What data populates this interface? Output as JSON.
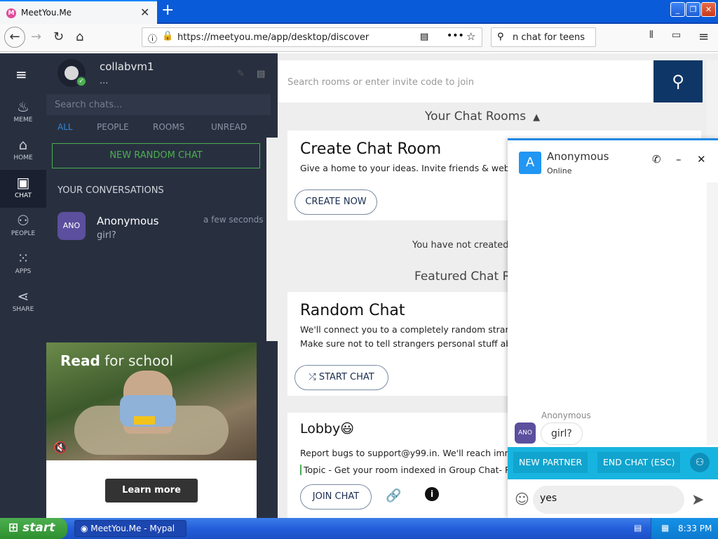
{
  "browser": {
    "tab_title": "MeetYou.Me",
    "tab_favicon": "M",
    "url": "https://meetyou.me/app/desktop/discover",
    "search_query": "n chat for teens"
  },
  "rail": [
    {
      "label": "MEME",
      "icon": "flame-icon",
      "glyph": "🔥"
    },
    {
      "label": "HOME",
      "icon": "home-icon",
      "glyph": "⌂"
    },
    {
      "label": "CHAT",
      "icon": "chat-icon",
      "glyph": "▣"
    },
    {
      "label": "PEOPLE",
      "icon": "people-icon",
      "glyph": "👥"
    },
    {
      "label": "APPS",
      "icon": "apps-icon",
      "glyph": "⁞⁞⁞"
    },
    {
      "label": "SHARE",
      "icon": "share-icon",
      "glyph": "⋖"
    }
  ],
  "profile": {
    "username": "collabvm1",
    "status": "..."
  },
  "chats": {
    "search_placeholder": "Search chats...",
    "filters": [
      "ALL",
      "PEOPLE",
      "ROOMS",
      "UNREAD"
    ],
    "new_random_label": "NEW RANDOM CHAT",
    "section_title": "YOUR CONVERSATIONS",
    "conversation": {
      "avatar": "ANO",
      "name": "Anonymous",
      "last_message": "girl?",
      "time": "a few seconds"
    }
  },
  "ad": {
    "headline_bold": "Read",
    "headline_rest": " for school",
    "cta": "Learn more"
  },
  "main": {
    "search_placeholder": "Search rooms or enter invite code to join",
    "your_rooms": "Your Chat Rooms",
    "create": {
      "title": "Create Chat Room",
      "desc": "Give a home to your ideas. Invite friends & web-",
      "button": "CREATE NOW"
    },
    "not_created": "You have not created",
    "featured": "Featured Chat Ro",
    "random": {
      "title": "Random Chat",
      "line1": "We'll connect you to a completely random strang",
      "line2": "Make sure not to tell strangers personal stuff ab",
      "button": "START CHAT"
    },
    "lobby": {
      "title": "Lobby😃",
      "line1": "Report bugs to support@y99.in. We'll reach imm",
      "line2": "Topic - Get your room indexed in Group Chat- R",
      "button": "JOIN CHAT"
    }
  },
  "chat_window": {
    "avatar": "A",
    "name": "Anonymous",
    "status": "Online",
    "sender": "Anonymous",
    "sender_avatar": "ANO",
    "message": "girl?",
    "new_partner": "NEW PARTNER",
    "end_chat": "END CHAT (ESC)",
    "input_value": "yes"
  },
  "taskbar": {
    "start": "start",
    "task": "MeetYou.Me - Mypal",
    "clock": "8:33 PM"
  }
}
